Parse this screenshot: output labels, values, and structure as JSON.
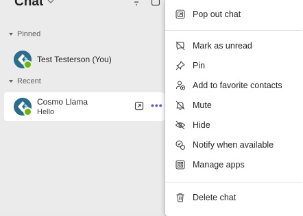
{
  "header": {
    "title": "Chat"
  },
  "sections": {
    "pinned": "Pinned",
    "recent": "Recent"
  },
  "chats": {
    "pinned_0": {
      "name": "Test Testerson (You)"
    },
    "recent_0": {
      "name": "Cosmo Llama",
      "preview": "Hello"
    }
  },
  "menu": {
    "items": [
      {
        "label": "Pop out chat",
        "icon": "popout-icon"
      },
      {
        "label": "Mark as unread",
        "icon": "mark-unread-icon"
      },
      {
        "label": "Pin",
        "icon": "pin-icon"
      },
      {
        "label": "Add to favorite contacts",
        "icon": "add-favorite-icon"
      },
      {
        "label": "Mute",
        "icon": "mute-icon"
      },
      {
        "label": "Hide",
        "icon": "hide-icon"
      },
      {
        "label": "Notify when available",
        "icon": "notify-icon"
      },
      {
        "label": "Manage apps",
        "icon": "apps-icon"
      },
      {
        "label": "Delete chat",
        "icon": "trash-icon"
      }
    ]
  },
  "colors": {
    "accent": "#5b5fc7",
    "presence_available": "#6bb700",
    "pane_background": "#ebebeb",
    "menu_background": "#ffffff"
  }
}
